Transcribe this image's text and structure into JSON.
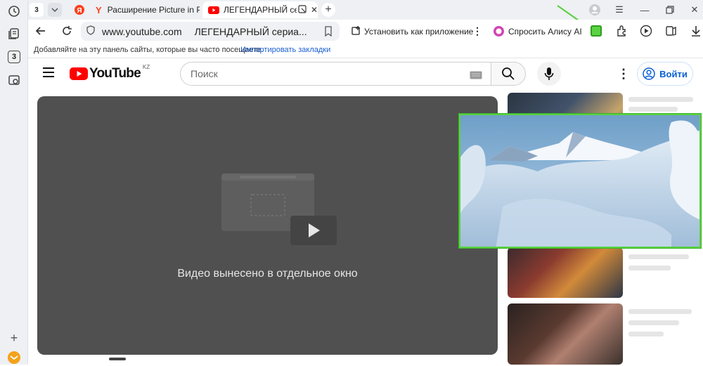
{
  "browser": {
    "tab_counter": "3",
    "sidebar_badge": "3",
    "tabs": [
      {
        "title": "Расширение Picture in Pic",
        "favicon": "yandex-y-icon"
      },
      {
        "title": "ЛЕГЕНДАРНЫЙ сер",
        "favicon": "youtube-icon",
        "active": true
      }
    ],
    "url_domain": "www.youtube.com",
    "url_page_title": "ЛЕГЕНДАРНЫЙ сериа...",
    "install_app_label": "Установить как приложение",
    "ask_alice_label": "Спросить Алису AI",
    "bookmarks_hint": "Добавляйте на эту панель сайты, которые вы часто посещаете.",
    "import_bookmarks_label": "Импортировать закладки"
  },
  "youtube": {
    "logo_text": "YouTube",
    "region": "KZ",
    "search_placeholder": "Поиск",
    "sign_in_label": "Войти",
    "pip_message": "Видео вынесено в отдельное окно"
  },
  "colors": {
    "accent_green": "#5ad241",
    "youtube_red": "#ff0000",
    "link_blue": "#065fd4"
  }
}
